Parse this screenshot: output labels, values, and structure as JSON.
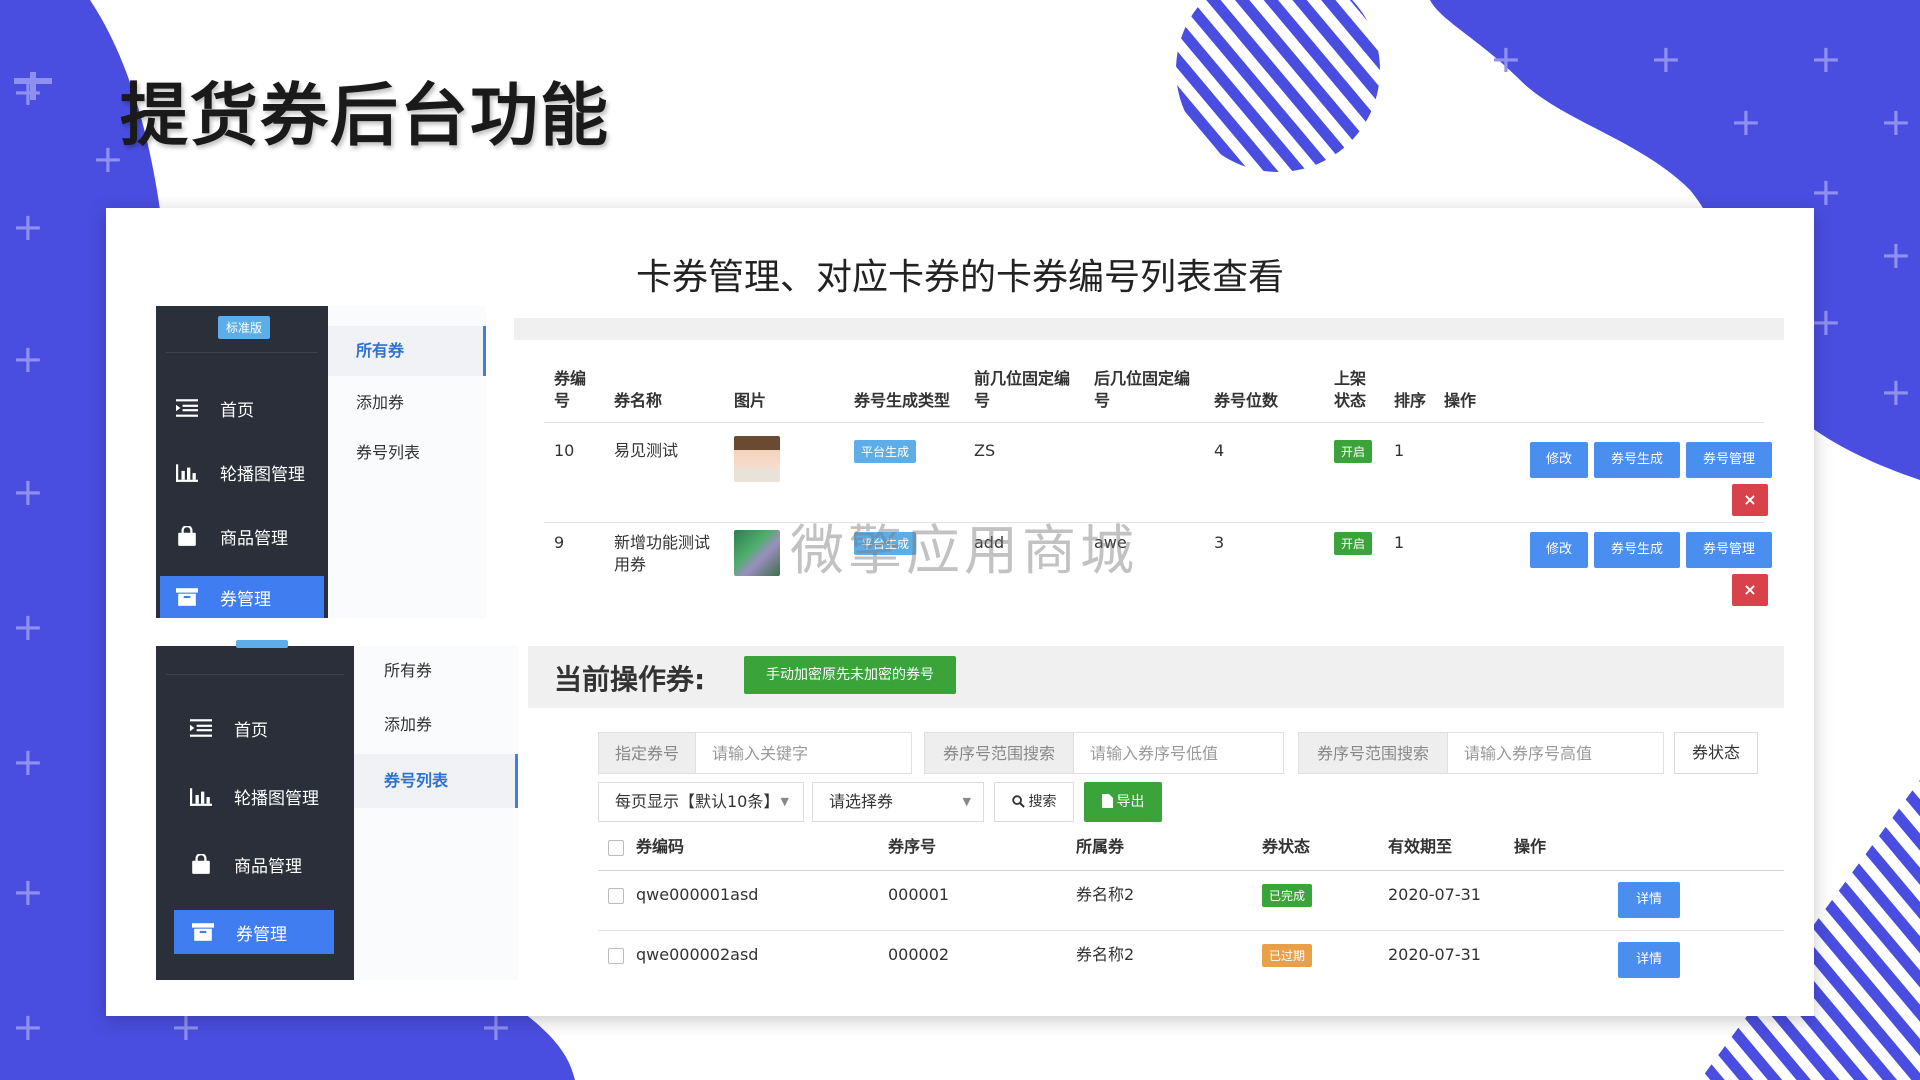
{
  "slide_title": "提货券后台功能",
  "subtitle": "卡券管理、对应卡券的卡券编号列表查看",
  "watermark": "微擎应用商城",
  "colors": {
    "primary": "#3f7df0",
    "sidebar": "#2b2f3a",
    "success": "#3aa43a",
    "danger": "#d9424a",
    "warning": "#e8a14a",
    "info": "#5dade9",
    "bg_blue": "#4a4ee0"
  },
  "panel1": {
    "badge": "标准版",
    "sidebar": [
      {
        "label": "首页",
        "icon": "list-icon"
      },
      {
        "label": "轮播图管理",
        "icon": "bar-chart-icon"
      },
      {
        "label": "商品管理",
        "icon": "bag-icon"
      },
      {
        "label": "券管理",
        "icon": "archive-icon",
        "active": true
      }
    ],
    "subnav": [
      {
        "label": "所有券",
        "active": true
      },
      {
        "label": "添加券"
      },
      {
        "label": "券号列表"
      }
    ],
    "headers": {
      "id": [
        "券编",
        "号"
      ],
      "name": "券名称",
      "image": "图片",
      "gen_type": "券号生成类型",
      "prefix": [
        "前几位固定编",
        "号"
      ],
      "suffix": [
        "后几位固定编",
        "号"
      ],
      "digits": "券号位数",
      "status": [
        "上架",
        "状态"
      ],
      "sort": "排序",
      "actions": "操作"
    },
    "rows": [
      {
        "id": "10",
        "name": "易见测试",
        "gen_type": "平台生成",
        "prefix": "ZS",
        "suffix": "",
        "digits": "4",
        "status": "开启",
        "sort": "1"
      },
      {
        "id": "9",
        "name": "新增功能测试用券",
        "gen_type": "平台生成",
        "prefix": "add",
        "suffix": "awe",
        "digits": "3",
        "status": "开启",
        "sort": "1"
      }
    ],
    "row_buttons": {
      "edit": "修改",
      "generate": "券号生成",
      "manage": "券号管理",
      "delete": "×"
    }
  },
  "panel2": {
    "sidebar": [
      {
        "label": "首页",
        "icon": "list-icon"
      },
      {
        "label": "轮播图管理",
        "icon": "bar-chart-icon"
      },
      {
        "label": "商品管理",
        "icon": "bag-icon"
      },
      {
        "label": "券管理",
        "icon": "archive-icon",
        "active": true
      }
    ],
    "subnav": [
      {
        "label": "所有券"
      },
      {
        "label": "添加券"
      },
      {
        "label": "券号列表",
        "active": true
      }
    ],
    "current_label": "当前操作券:",
    "encrypt_button": "手动加密原先未加密的券号",
    "filters": {
      "code_label": "指定券号",
      "code_placeholder": "请输入关键字",
      "range_label_low": "券序号范围搜索",
      "range_low_placeholder": "请输入券序号低值",
      "range_label_high": "券序号范围搜索",
      "range_high_placeholder": "请输入券序号高值",
      "status_label": "券状态",
      "page_size": "每页显示【默认10条】",
      "select_coupon": "请选择券",
      "search_button": "搜索",
      "export_button": "导出"
    },
    "headers": {
      "code": "券编码",
      "serial": "券序号",
      "coupon": "所属券",
      "status": "券状态",
      "expire": "有效期至",
      "actions": "操作"
    },
    "rows": [
      {
        "code": "qwe000001asd",
        "serial": "000001",
        "coupon": "券名称2",
        "status": "已完成",
        "status_color": "#3aa43a",
        "expire": "2020-07-31",
        "action": "详情"
      },
      {
        "code": "qwe000002asd",
        "serial": "000002",
        "coupon": "券名称2",
        "status": "已过期",
        "status_color": "#e8a14a",
        "expire": "2020-07-31",
        "action": "详情"
      }
    ]
  }
}
